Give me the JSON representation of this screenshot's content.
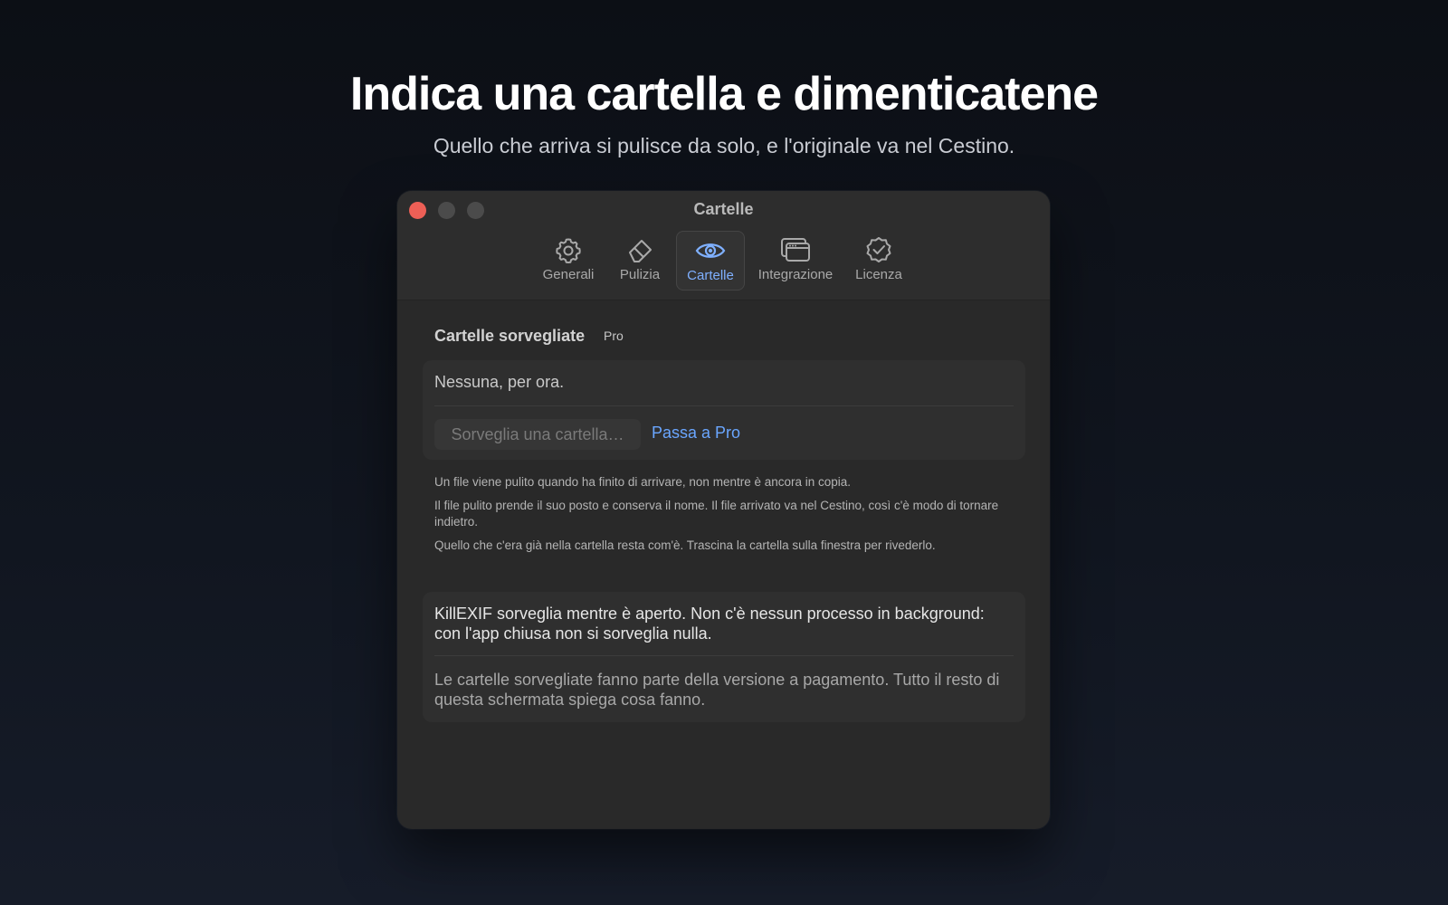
{
  "hero": {
    "title": "Indica una cartella e dimenticatene",
    "subtitle": "Quello che arriva si pulisce da solo, e l'originale va nel Cestino."
  },
  "window": {
    "title": "Cartelle"
  },
  "toolbar": {
    "items": [
      {
        "label": "Generali",
        "icon": "gear-icon"
      },
      {
        "label": "Pulizia",
        "icon": "eraser-icon"
      },
      {
        "label": "Cartelle",
        "icon": "eye-icon",
        "active": true
      },
      {
        "label": "Integrazione",
        "icon": "windows-icon"
      },
      {
        "label": "Licenza",
        "icon": "checkmark-seal-icon"
      }
    ]
  },
  "section": {
    "header": "Cartelle sorvegliate",
    "badge": "Pro"
  },
  "watched": {
    "empty_text": "Nessuna, per ora.",
    "watch_button": "Sorveglia una cartella…",
    "upgrade_link": "Passa a Pro"
  },
  "notes": [
    "Un file viene pulito quando ha finito di arrivare, non mentre è ancora in copia.",
    "Il file pulito prende il suo posto e conserva il nome. Il file arrivato va nel Cestino, così c'è modo di tornare indietro.",
    "Quello che c'era già nella cartella resta com'è. Trascina la cartella sulla finestra per rivederlo."
  ],
  "info": {
    "primary": "KillEXIF sorveglia mentre è aperto. Non c'è nessun processo in background: con l'app chiusa non si sorveglia nulla.",
    "secondary": "Le cartelle sorvegliate fanno parte della versione a pagamento. Tutto il resto di questa schermata spiega cosa fanno."
  },
  "colors": {
    "accent": "#6aa6ff",
    "close": "#ed5f56",
    "window_bg": "#292929"
  }
}
